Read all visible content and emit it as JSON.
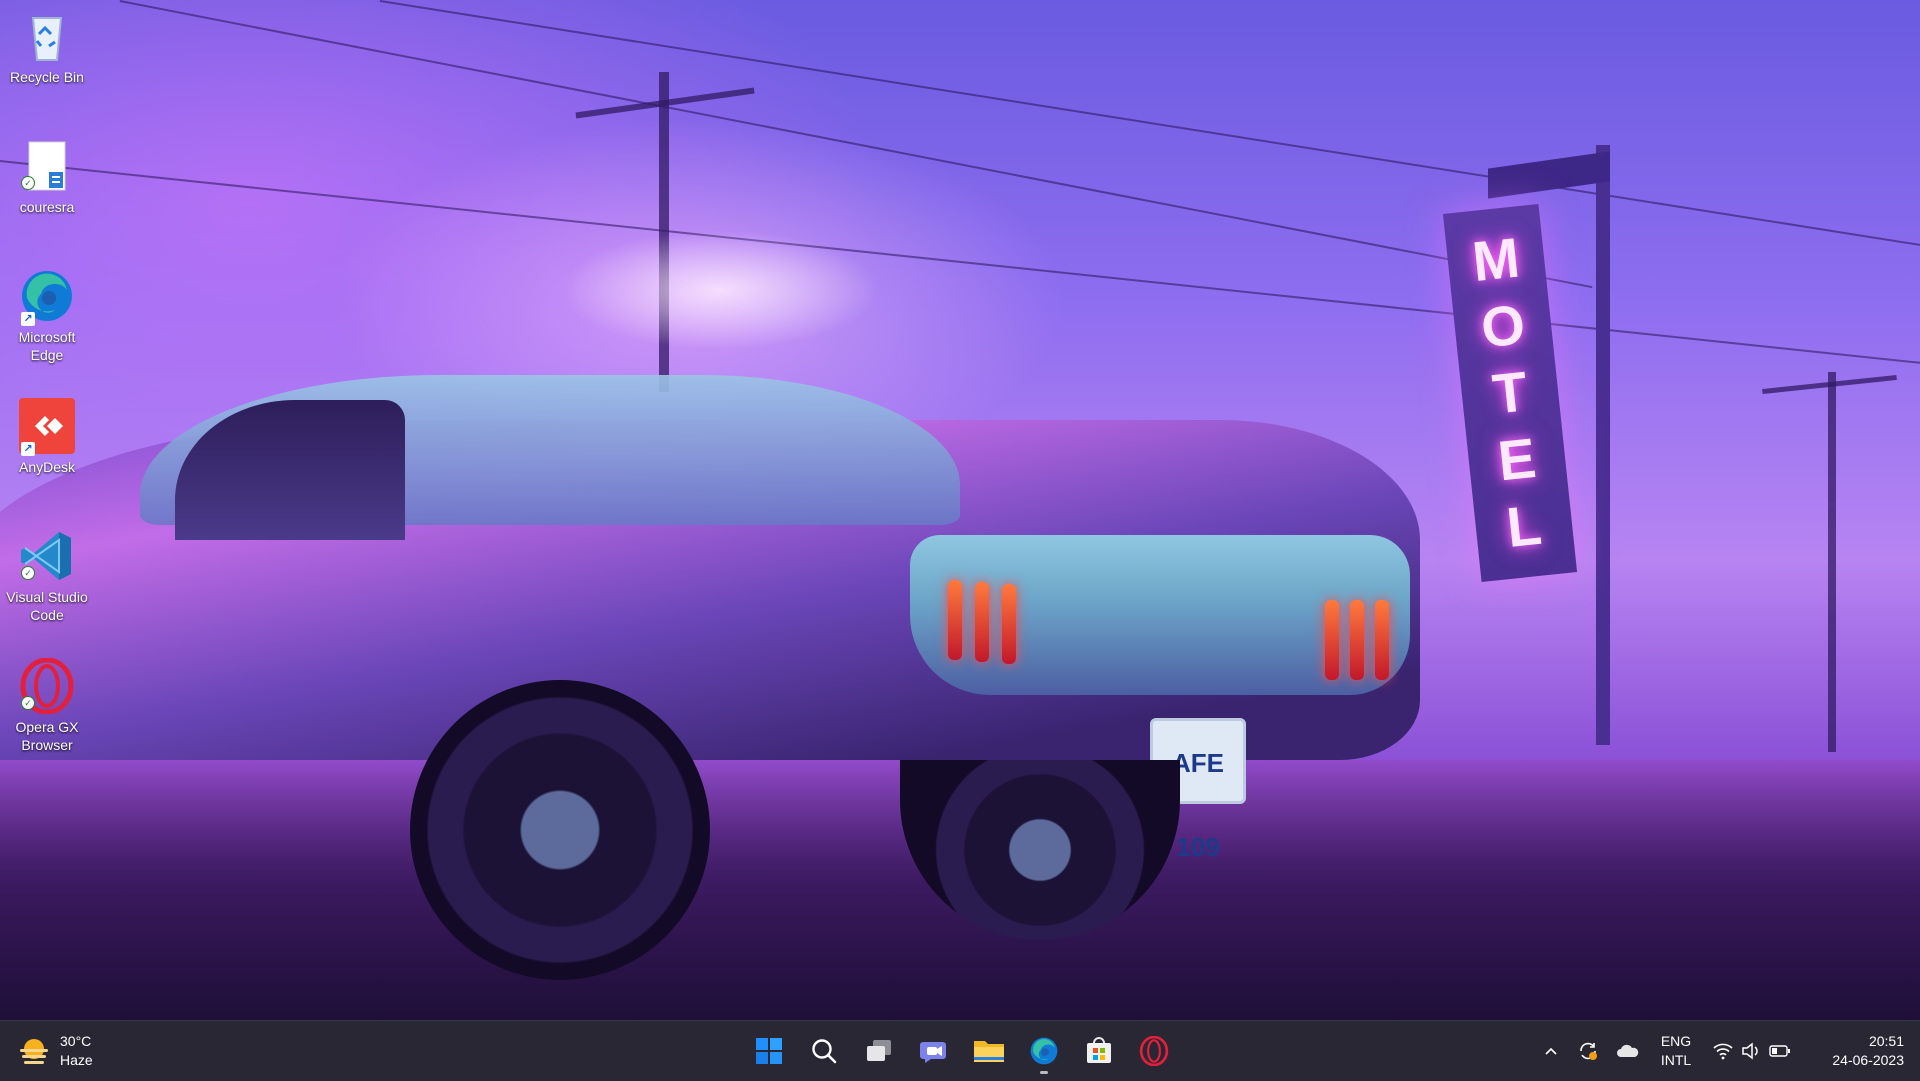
{
  "desktop": {
    "wallpaper": {
      "motel_sign_letters": [
        "M",
        "O",
        "T",
        "E",
        "L"
      ],
      "license_plate": "AFE 109"
    },
    "icons": [
      {
        "label": "Recycle Bin",
        "icon": "recycle-bin-icon"
      },
      {
        "label": "couresra",
        "icon": "text-file-icon"
      },
      {
        "label": "Microsoft Edge",
        "icon": "edge-icon"
      },
      {
        "label": "AnyDesk",
        "icon": "anydesk-icon"
      },
      {
        "label": "Visual Studio Code",
        "icon": "vscode-icon"
      },
      {
        "label": "Opera GX Browser",
        "icon": "opera-gx-icon"
      }
    ]
  },
  "taskbar": {
    "weather": {
      "temperature": "30°C",
      "condition": "Haze",
      "icon": "haze-sun-icon"
    },
    "pinned": [
      {
        "name": "Start",
        "icon": "windows-start-icon"
      },
      {
        "name": "Search",
        "icon": "search-icon"
      },
      {
        "name": "Task View",
        "icon": "task-view-icon"
      },
      {
        "name": "Chat",
        "icon": "teams-chat-icon"
      },
      {
        "name": "File Explorer",
        "icon": "file-explorer-icon"
      },
      {
        "name": "Microsoft Edge",
        "icon": "edge-icon",
        "active": true
      },
      {
        "name": "Microsoft Store",
        "icon": "store-icon"
      },
      {
        "name": "Opera GX",
        "icon": "opera-gx-icon"
      }
    ],
    "tray": {
      "language_line1": "ENG",
      "language_line2": "INTL",
      "time": "20:51",
      "date": "24-06-2023"
    }
  },
  "colors": {
    "taskbar_bg": "#201e2c",
    "windows_blue": "#1f8fff",
    "opera_red": "#e3203b",
    "anydesk_red": "#ef443b",
    "vscode_blue": "#2489ca"
  }
}
